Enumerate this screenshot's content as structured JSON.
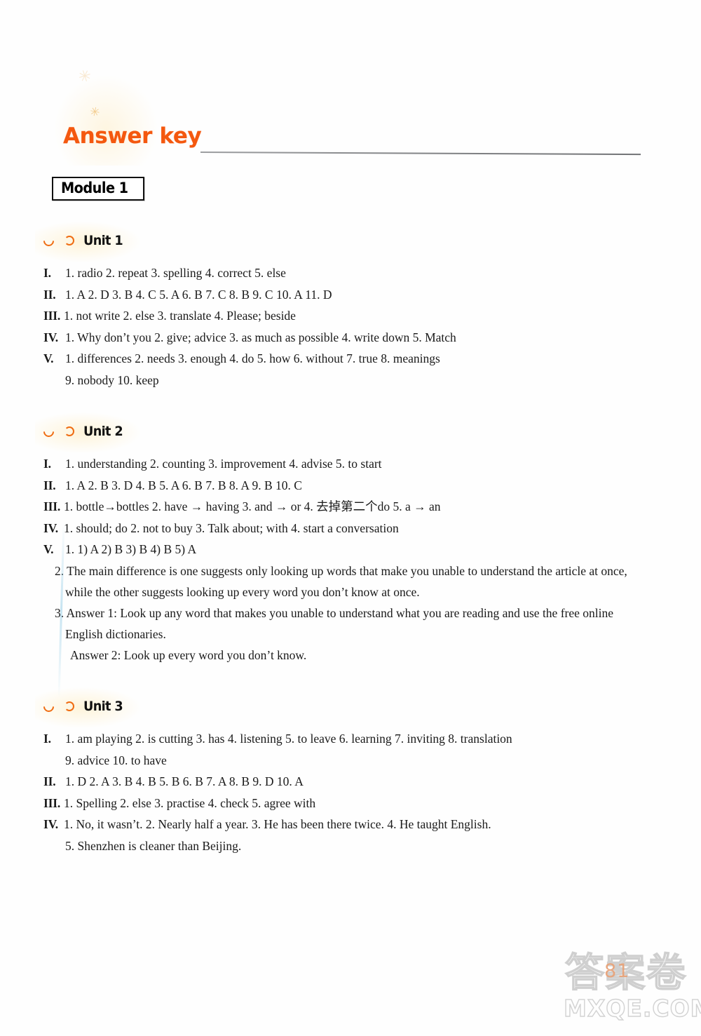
{
  "header": {
    "title": "Answer key",
    "title_color": "#f4580f",
    "doodle_top": "✳",
    "doodle_small": "✳"
  },
  "module": {
    "label": "Module 1"
  },
  "units": [
    {
      "heading": "Unit 1",
      "marker_icon": "crescent-icon",
      "answers": [
        {
          "roman": "I.",
          "text": "1. radio   2. repeat   3. spelling   4. correct   5. else"
        },
        {
          "roman": "II.",
          "text": "1. A   2. D   3. B   4. C   5. A   6. B   7. C   8. B   9. C   10. A   11. D"
        },
        {
          "roman": "III.",
          "text": "1. not write   2. else   3. translate   4. Please; beside"
        },
        {
          "roman": "IV.",
          "text": "1. Why don’t you   2. give; advice   3. as much as possible   4. write down   5. Match"
        },
        {
          "roman": "V.",
          "text": "1. differences   2. needs   3. enough   4. do   5. how   6. without   7. true   8. meanings",
          "continuation": "9. nobody   10. keep"
        }
      ]
    },
    {
      "heading": "Unit 2",
      "marker_icon": "crescent-icon",
      "answers": [
        {
          "roman": "I.",
          "text": "1. understanding   2. counting   3. improvement   4. advise   5. to start"
        },
        {
          "roman": "II.",
          "text": "1. A   2. B   3. D   4. B   5. A   6. B   7. B   8. A   9. B   10. C"
        },
        {
          "roman": "III.",
          "text": "1. bottle→bottles   2. have → having   3. and → or   4. 去掉第二个do   5. a → an"
        },
        {
          "roman": "IV.",
          "text": "1. should; do   2. not to buy   3. Talk about; with   4. start a conversation"
        },
        {
          "roman": "V.",
          "text": "1. 1) A   2) B   3) B   4) B   5) A"
        }
      ],
      "paragraphs": [
        "2. The main difference is one suggests only looking up words that make you unable to understand the article at once,",
        "while the other suggests looking up every word you don’t know at once.",
        "3. Answer 1: Look up any word that makes you unable to understand what you are reading and use the free online",
        "English dictionaries.",
        "Answer 2: Look up every word you don’t know."
      ]
    },
    {
      "heading": "Unit 3",
      "marker_icon": "crescent-icon",
      "answers": [
        {
          "roman": "I.",
          "text": "1. am playing   2. is cutting   3. has   4. listening   5. to leave   6. learning   7. inviting   8. translation",
          "continuation": "9. advice   10. to have"
        },
        {
          "roman": "II.",
          "text": "1. D   2. A   3. B   4. B   5. B   6. B   7. A   8. B   9. D   10. A"
        },
        {
          "roman": "III.",
          "text": "1. Spelling   2. else   3. practise   4. check   5. agree with"
        },
        {
          "roman": "IV.",
          "text": "1. No, it wasn’t.   2. Nearly half a year.   3. He has been there twice.   4. He taught English.",
          "continuation": "5. Shenzhen is cleaner than Beijing."
        }
      ]
    }
  ],
  "watermark": {
    "chinese": "答案卷",
    "domain": "MXQE.COM",
    "page_number": "81",
    "page_number_color": "#e8a37a"
  }
}
